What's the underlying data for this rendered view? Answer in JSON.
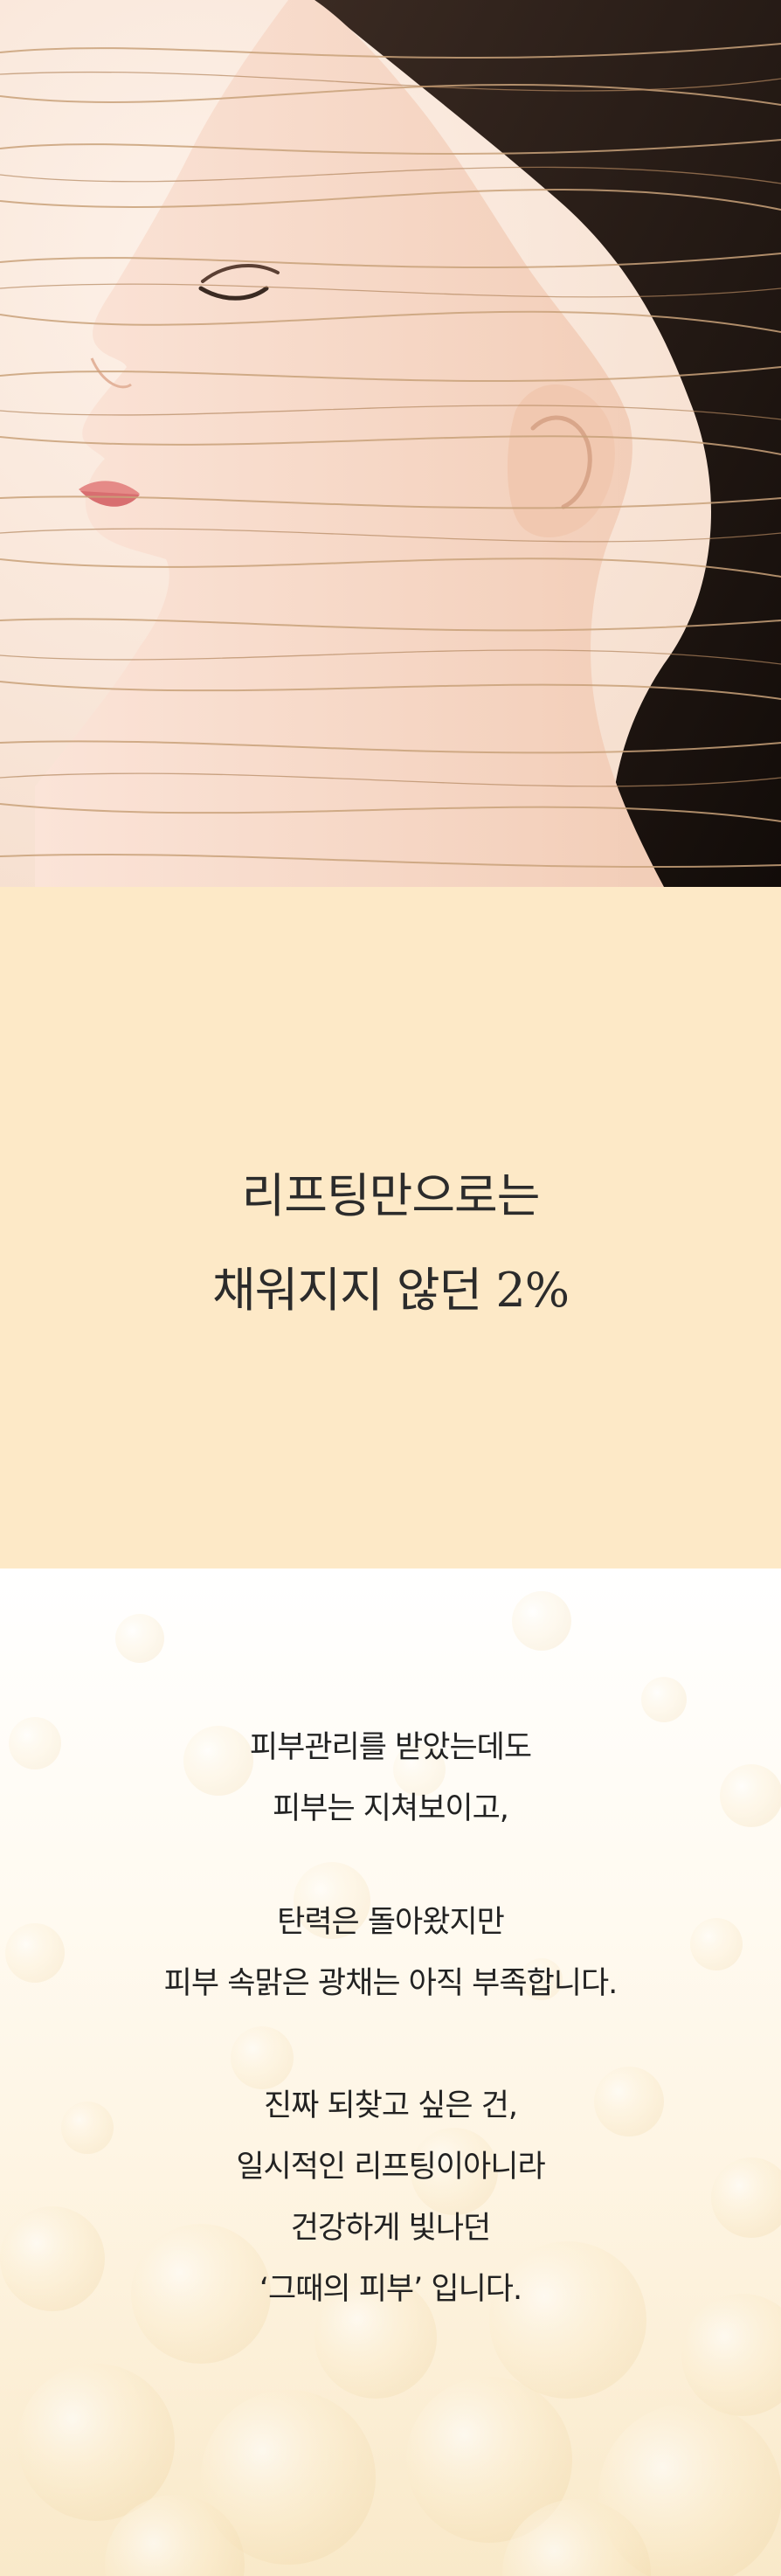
{
  "headline": {
    "line1": "리프팅만으로는",
    "line2": "채워지지 않던 2%"
  },
  "copy": {
    "para1": [
      "피부관리를 받았는데도",
      "피부는 지쳐보이고,"
    ],
    "para2": [
      "탄력은 돌아왔지만",
      "피부 속맑은 광채는 아직 부족합니다."
    ],
    "para3": [
      "진짜 되찾고 싶은 건,",
      "일시적인 리프팅이아니라",
      "건강하게 빛나던",
      "‘그때의 피부’ 입니다."
    ]
  },
  "colors": {
    "hero_bg": "#fbe9dc",
    "band_bg": "#fde9c7",
    "text": "#222222",
    "thread": "#c9a27a"
  }
}
